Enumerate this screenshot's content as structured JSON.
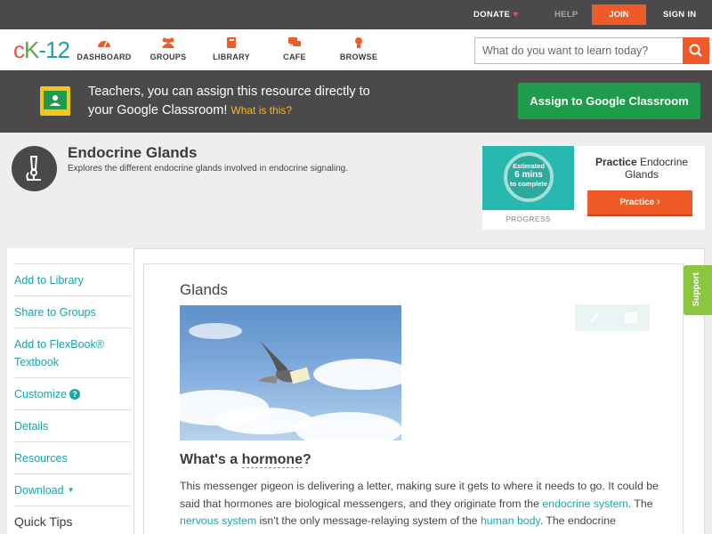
{
  "topbar": {
    "donate": "DONATE",
    "help": "HELP",
    "join": "JOIN",
    "signin": "SIGN IN"
  },
  "brand": {
    "logo": "ck-12",
    "colors": {
      "accent": "#ef5a29",
      "link": "#1aa3a7",
      "dark": "#4b4949",
      "google_green": "#1e9c4b"
    }
  },
  "nav": {
    "items": [
      {
        "label": "DASHBOARD",
        "icon": "dashboard-icon"
      },
      {
        "label": "GROUPS",
        "icon": "groups-icon"
      },
      {
        "label": "LIBRARY",
        "icon": "library-icon"
      },
      {
        "label": "CAFE",
        "icon": "cafe-icon"
      },
      {
        "label": "BROWSE",
        "icon": "browse-icon"
      }
    ]
  },
  "search": {
    "placeholder": "What do you want to learn today?"
  },
  "classroom": {
    "line1": "Teachers, you can assign this resource directly to",
    "line2": "your Google Classroom!",
    "what": "What is this?",
    "assign_label": "Assign to Google Classroom"
  },
  "concept": {
    "title": "Endocrine Glands",
    "description": "Explores the different endocrine glands involved in endocrine signaling."
  },
  "practice": {
    "estimated": "Estimated",
    "minutes": "6 mins",
    "to_complete": "to complete",
    "progress_label": "PROGRESS",
    "title_bold": "Practice",
    "title_rest": "Endocrine Glands",
    "button": "Practice"
  },
  "sidebar": {
    "items": [
      {
        "label": "Add to Library"
      },
      {
        "label": "Share to Groups"
      },
      {
        "label": "Add to FlexBook® Textbook"
      },
      {
        "label": "Customize"
      },
      {
        "label": "Details"
      },
      {
        "label": "Resources"
      },
      {
        "label": "Download"
      }
    ],
    "quick_tips": "Quick Tips"
  },
  "content": {
    "heading": "Glands",
    "subheading_prefix": "What's a ",
    "subheading_term": "hormone",
    "subheading_suffix": "?",
    "para": {
      "s1": "This messenger pigeon is delivering a letter, making sure it gets to where it needs to go. It could be said that hormones are biological messengers, and they originate from the ",
      "link1": "endocrine system",
      "s2": ". The ",
      "link2": "nervous system",
      "s3": " isn't the only message-relaying system of the ",
      "link3": "human body",
      "s4": ". The endocrine"
    }
  },
  "support": "Support"
}
